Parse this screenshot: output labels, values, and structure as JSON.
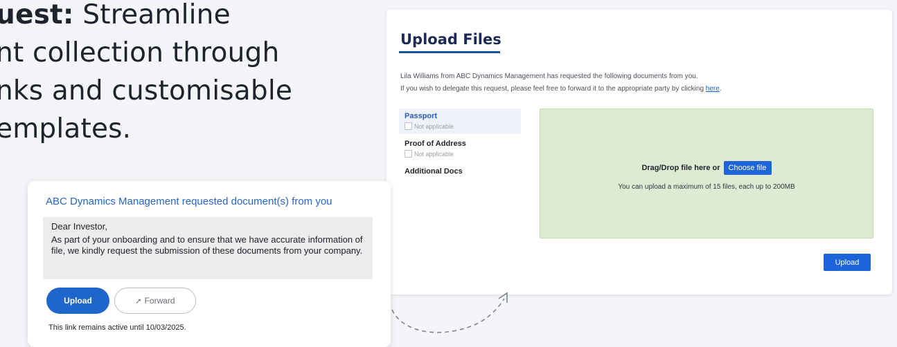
{
  "headline": {
    "line1_bold": "uest:",
    "line1_rest": " Streamline",
    "line2": "nt collection through",
    "line3": "nks and customisable",
    "line4": "emplates."
  },
  "upload_panel": {
    "title": "Upload Files",
    "intro_line1": "Lila Williams from ABC Dynamics Management has requested the following documents from you.",
    "intro_line2_prefix": "If you wish to delegate this request, please feel free to forward it to the appropriate party by clicking ",
    "intro_link": "here",
    "intro_line2_suffix": ".",
    "documents": [
      {
        "name": "Passport",
        "not_applicable": "Not applicable"
      },
      {
        "name": "Proof of Address",
        "not_applicable": "Not applicable"
      },
      {
        "name": "Additional Docs"
      }
    ],
    "dropzone": {
      "drag_text": "Drag/Drop file here or",
      "choose_label": "Choose file",
      "limit_text": "You can upload a maximum of 15 files, each up to 200MB"
    },
    "upload_label": "Upload",
    "colors": {
      "accent": "#1d65d8",
      "dropzone": "#dcebd2",
      "title_underline": "#1b4fa0"
    }
  },
  "email_card": {
    "subject": "ABC Dynamics Management requested document(s) from you",
    "greeting": "Dear Investor,",
    "body": "As part of your onboarding and to ensure that we have accurate information of file, we kindly request the submission of these documents from your company.",
    "upload_label": "Upload",
    "forward_label": "Forward",
    "forward_icon": "arrow-right-icon",
    "expiry": "This link remains active until 10/03/2025."
  }
}
